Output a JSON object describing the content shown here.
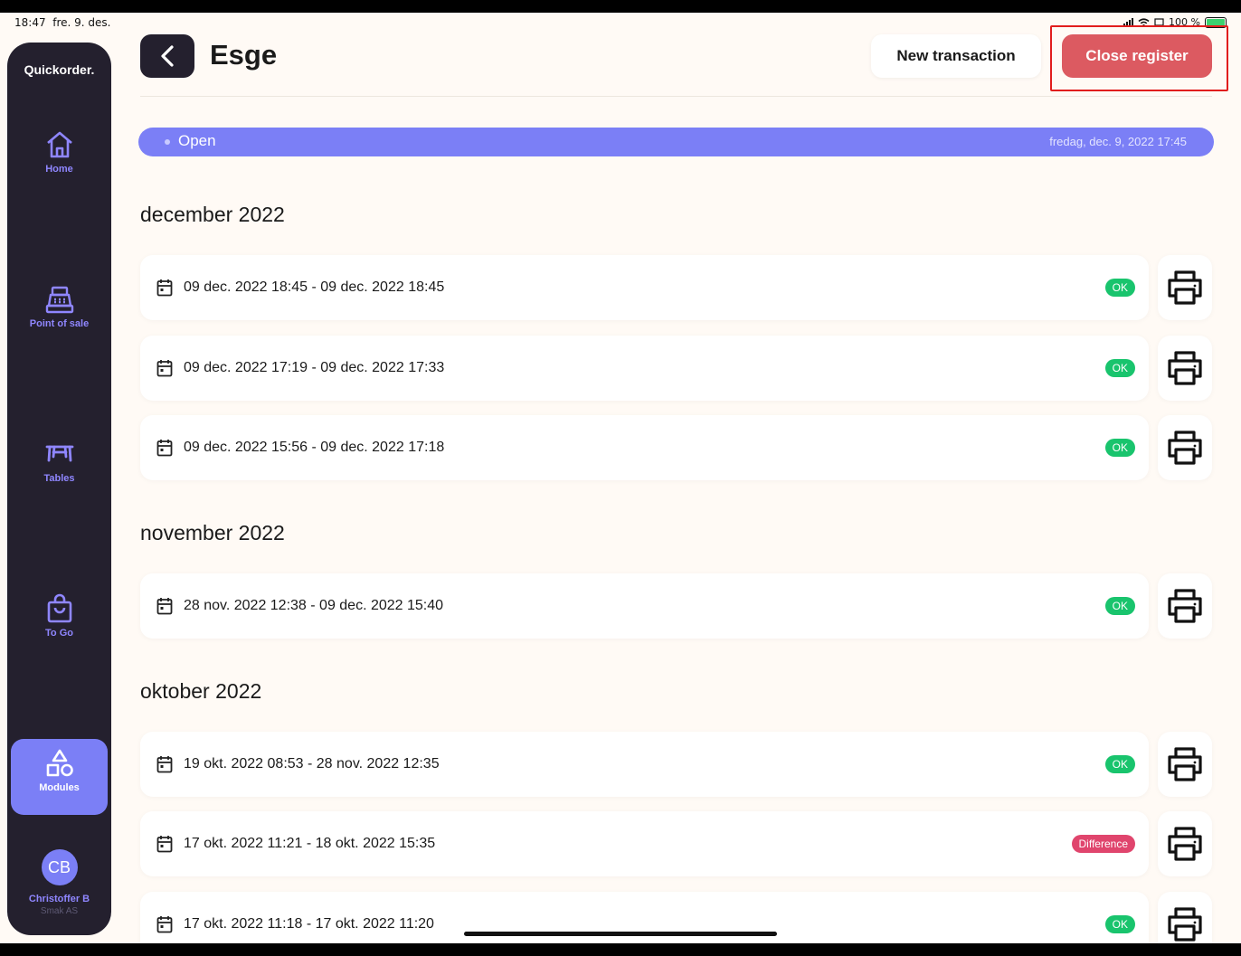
{
  "status_bar": {
    "time": "18:47",
    "date": "fre. 9. des.",
    "battery": "100 %"
  },
  "sidebar": {
    "logo": "Quickorder.",
    "items": [
      {
        "label": "Home",
        "icon": "home-icon"
      },
      {
        "label": "Point of sale",
        "icon": "cash-register-icon"
      },
      {
        "label": "Tables",
        "icon": "table-icon"
      },
      {
        "label": "To Go",
        "icon": "shopping-bag-icon"
      },
      {
        "label": "Modules",
        "icon": "shapes-icon",
        "active": true
      }
    ],
    "user": {
      "initials": "CB",
      "name": "Christoffer B",
      "company": "Smak AS"
    }
  },
  "header": {
    "title": "Esge",
    "new_transaction_label": "New transaction",
    "close_register_label": "Close register"
  },
  "banner": {
    "status": "Open",
    "opened_at": "fredag, dec. 9, 2022 17:45",
    "color": "#7b7ff6"
  },
  "months": [
    {
      "label": "december 2022",
      "sessions": [
        {
          "period": "09 dec. 2022 18:45 - 09 dec. 2022 18:45",
          "status": "OK"
        },
        {
          "period": "09 dec. 2022 17:19 - 09 dec. 2022 17:33",
          "status": "OK"
        },
        {
          "period": "09 dec. 2022 15:56 - 09 dec. 2022 17:18",
          "status": "OK"
        }
      ]
    },
    {
      "label": "november 2022",
      "sessions": [
        {
          "period": "28 nov. 2022 12:38 - 09 dec. 2022 15:40",
          "status": "OK"
        }
      ]
    },
    {
      "label": "oktober 2022",
      "sessions": [
        {
          "period": "19 okt. 2022 08:53 - 28 nov. 2022 12:35",
          "status": "OK"
        },
        {
          "period": "17 okt. 2022 11:21 - 18 okt. 2022 15:35",
          "status": "Difference"
        },
        {
          "period": "17 okt. 2022 11:18 - 17 okt. 2022 11:20",
          "status": "OK"
        }
      ]
    }
  ],
  "colors": {
    "accent": "#7b7ff6",
    "sidebar": "#24202e",
    "danger": "#dc5a61",
    "ok": "#19c46d",
    "difference": "#e0456d"
  }
}
